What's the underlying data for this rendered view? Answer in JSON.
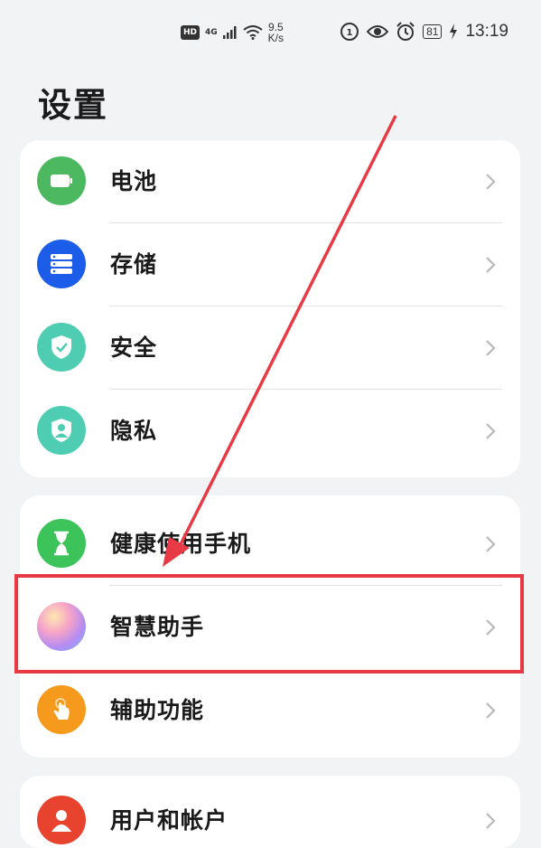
{
  "status_bar": {
    "hd": "HD",
    "signal": "4G",
    "speed_value": "9.5",
    "speed_unit": "K/s",
    "battery": "81",
    "time": "13:19"
  },
  "page": {
    "title": "设置"
  },
  "groups": [
    {
      "items": [
        {
          "label": "电池",
          "icon": "battery-icon",
          "color": "#4cb960"
        },
        {
          "label": "存储",
          "icon": "storage-icon",
          "color": "#1b5de8"
        },
        {
          "label": "安全",
          "icon": "security-shield-icon",
          "color": "#4ecdb3"
        },
        {
          "label": "隐私",
          "icon": "privacy-icon",
          "color": "#4ecdb3"
        }
      ]
    },
    {
      "items": [
        {
          "label": "健康使用手机",
          "icon": "hourglass-icon",
          "color": "#3cc35a"
        },
        {
          "label": "智慧助手",
          "icon": "smart-assistant-icon",
          "color": "#c18cf0"
        },
        {
          "label": "辅助功能",
          "icon": "accessibility-hand-icon",
          "color": "#f59a1c"
        }
      ]
    },
    {
      "items": [
        {
          "label": "用户和帐户",
          "icon": "user-icon",
          "color": "#e8432f"
        }
      ]
    }
  ],
  "annotation": {
    "highlight_color": "#e83a45",
    "highlighted_item": "智慧助手"
  }
}
